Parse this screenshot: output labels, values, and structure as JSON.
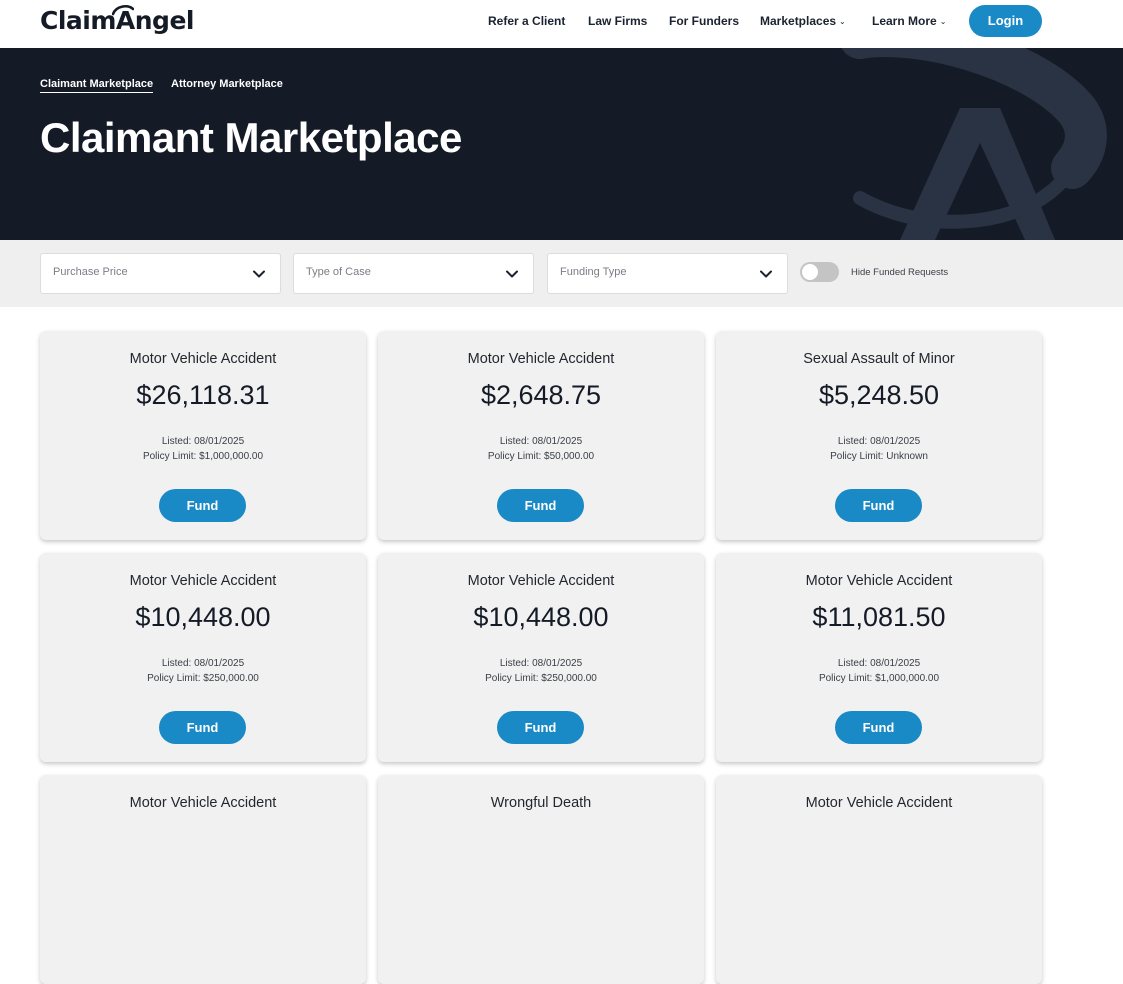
{
  "brand": {
    "logo_text": "ClaimAngel",
    "accent_color": "#1a8ac6",
    "dark_color": "#141b26"
  },
  "nav": {
    "items": [
      {
        "label": "Refer a Client",
        "has_caret": false
      },
      {
        "label": "Law Firms",
        "has_caret": false
      },
      {
        "label": "For Funders",
        "has_caret": false
      },
      {
        "label": "Marketplaces",
        "has_caret": true
      },
      {
        "label": "Learn More",
        "has_caret": true
      }
    ],
    "caret_icon": "chevron-down-icon",
    "login_label": "Login"
  },
  "hero": {
    "tabs": [
      {
        "label": "Claimant Marketplace",
        "active": true
      },
      {
        "label": "Attorney Marketplace",
        "active": false
      }
    ],
    "title": "Claimant Marketplace"
  },
  "filters": {
    "dropdowns": [
      {
        "placeholder": "Purchase Price"
      },
      {
        "placeholder": "Type of Case"
      },
      {
        "placeholder": "Funding Type"
      }
    ],
    "chevron_icon": "chevron-down-icon",
    "toggle": {
      "label": "Hide Funded Requests",
      "on": false
    }
  },
  "listings": [
    {
      "type": "Motor Vehicle Accident",
      "amount": "$26,118.31",
      "listed": "Listed: 08/01/2025",
      "limit": "Policy Limit: $1,000,000.00",
      "button": "Fund"
    },
    {
      "type": "Motor Vehicle Accident",
      "amount": "$2,648.75",
      "listed": "Listed: 08/01/2025",
      "limit": "Policy Limit: $50,000.00",
      "button": "Fund"
    },
    {
      "type": "Sexual Assault of Minor",
      "amount": "$5,248.50",
      "listed": "Listed: 08/01/2025",
      "limit": "Policy Limit: Unknown",
      "button": "Fund"
    },
    {
      "type": "Motor Vehicle Accident",
      "amount": "$10,448.00",
      "listed": "Listed: 08/01/2025",
      "limit": "Policy Limit: $250,000.00",
      "button": "Fund"
    },
    {
      "type": "Motor Vehicle Accident",
      "amount": "$10,448.00",
      "listed": "Listed: 08/01/2025",
      "limit": "Policy Limit: $250,000.00",
      "button": "Fund"
    },
    {
      "type": "Motor Vehicle Accident",
      "amount": "$11,081.50",
      "listed": "Listed: 08/01/2025",
      "limit": "Policy Limit: $1,000,000.00",
      "button": "Fund"
    },
    {
      "type": "Motor Vehicle Accident"
    },
    {
      "type": "Wrongful Death"
    },
    {
      "type": "Motor Vehicle Accident"
    }
  ]
}
